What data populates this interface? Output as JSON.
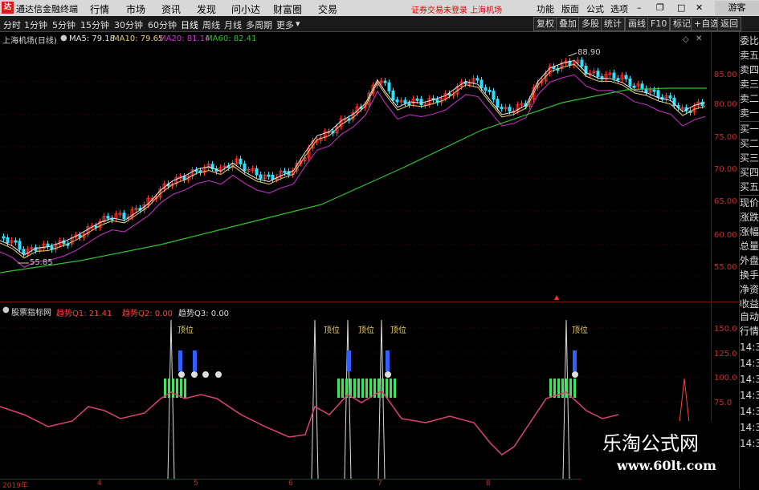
{
  "titlebar": {
    "app_name": "通达信金融终端",
    "menus": [
      "行情",
      "市场",
      "资讯",
      "发现",
      "问小达",
      "财富圈",
      "交易"
    ],
    "alert": "证券交易未登录  上海机场",
    "right_buttons": [
      "功能",
      "版面",
      "公式",
      "选项"
    ],
    "guest": "游客"
  },
  "toolbar": {
    "timeframes": [
      "分时",
      "1分钟",
      "5分钟",
      "15分钟",
      "30分钟",
      "60分钟",
      "日线",
      "周线",
      "月线",
      "多周期",
      "更多"
    ],
    "active_timeframe": "日线",
    "right_buttons": [
      "复权",
      "叠加",
      "多股",
      "统计",
      "画线",
      "F10",
      "标记",
      "+自选",
      "返回"
    ]
  },
  "main": {
    "stock_title": "上海机场(日线)",
    "ma_legend": [
      {
        "label": "MA5: 79.18",
        "color": "#e8e8e8"
      },
      {
        "label": "MA10: 79.65",
        "color": "#e8d070"
      },
      {
        "label": "MA20: 81.14",
        "color": "#d030d0"
      },
      {
        "label": "MA60: 82.41",
        "color": "#30c030"
      }
    ],
    "high_label": "88.90",
    "low_label": "55.85",
    "y_ticks": [
      "85.00",
      "80.00",
      "75.00",
      "70.00",
      "65.00",
      "60.00",
      "55.00"
    ]
  },
  "indicator": {
    "name": "股票指标网",
    "q1": "趋势Q1: 21.41",
    "q2": "趋势Q2: 0.00",
    "q3": "趋势Q3: 0.00",
    "top_label": "顶位",
    "y_ticks": [
      "150.0",
      "125.0",
      "100.0",
      "75.0"
    ]
  },
  "date_axis": [
    "2019年",
    "4",
    "5",
    "6",
    "7",
    "8"
  ],
  "side_panel": {
    "items": [
      "委比",
      "卖五",
      "卖四",
      "卖三",
      "卖二",
      "卖一",
      "买一",
      "买二",
      "买三",
      "买四",
      "买五",
      "现价",
      "涨跌",
      "涨幅",
      "总量",
      "外盘",
      "换手",
      "净资",
      "收益"
    ],
    "items2": [
      "自动",
      "行情",
      "14:3",
      "14:3",
      "14:3",
      "14:3",
      "14:3",
      "14:3",
      "14:3"
    ]
  },
  "watermark": {
    "title": "乐淘公式网",
    "url": "www.60lt.com"
  },
  "colors": {
    "up": "#ff3030",
    "down": "#30e0ff",
    "bg": "#000000",
    "grid": "#7a1010"
  }
}
